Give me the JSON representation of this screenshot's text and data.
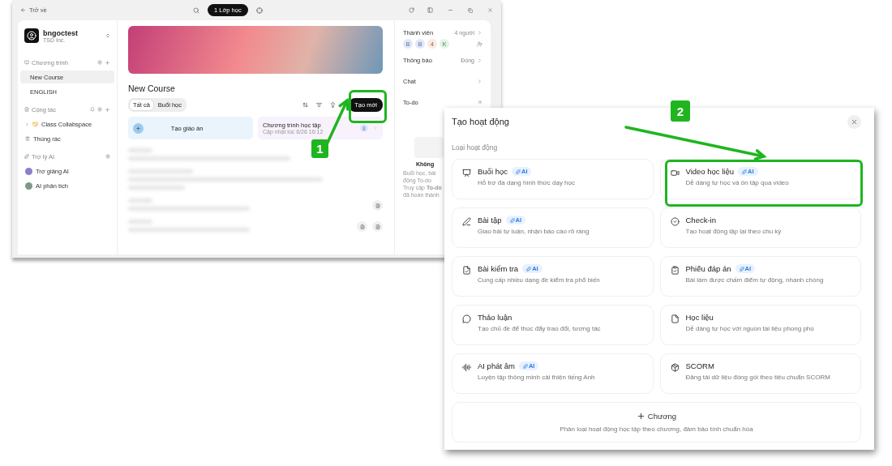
{
  "back_window": {
    "top_bar": {
      "back": "Trở về",
      "class_pill": "1 Lớp học"
    },
    "workspace": {
      "name": "bngoctest",
      "org": "TSD Inc."
    },
    "sidebar": [
      {
        "title": "Chương trình",
        "kind": "program",
        "items": [
          {
            "label": "New Course",
            "kind": "page",
            "selected": true
          },
          {
            "label": "ENGLISH",
            "kind": "page",
            "selected": false
          }
        ]
      },
      {
        "title": "Cộng tác",
        "kind": "collab",
        "items": [
          {
            "label": "Class Collabspace",
            "kind": "folder",
            "selected": false
          },
          {
            "label": "Thùng rác",
            "kind": "trash",
            "selected": false
          }
        ]
      },
      {
        "title": "Trợ lý AI",
        "kind": "ai",
        "items": [
          {
            "label": "Trợ giảng AI",
            "kind": "agent",
            "selected": false
          },
          {
            "label": "AI phân tích",
            "kind": "agent",
            "selected": false
          }
        ]
      }
    ],
    "course": {
      "title": "New Course",
      "tabs": [
        {
          "label": "Tất cả",
          "selected": true
        },
        {
          "label": "Buổi học",
          "selected": false
        }
      ],
      "create_button": "Tạo mới",
      "cards": [
        {
          "kind": "action",
          "title": "Tạo giáo án"
        },
        {
          "kind": "program",
          "title": "Chương trình học tập",
          "subtitle": "Cập nhật lúc 6/26 16:12",
          "count": "8"
        }
      ]
    },
    "right_panel": {
      "rows": [
        {
          "label": "Thành viên",
          "value": "4 người",
          "kind": "link"
        },
        {
          "label": "Thông báo",
          "value": "Đóng",
          "kind": "link"
        },
        {
          "label": "Chat",
          "kind": "link"
        },
        {
          "label": "To-do",
          "kind": "external"
        }
      ],
      "members": [
        {
          "initial": "B",
          "color": "#dfe8fb"
        },
        {
          "initial": "B",
          "color": "#dfe8fb"
        },
        {
          "initial": "4",
          "color": "#fbe9dc"
        },
        {
          "initial": "K",
          "color": "#e1f5e3"
        }
      ],
      "empty_title": "Không",
      "empty_lines": [
        "Buổi học, bài",
        "động To-do",
        "Truy cập **To-do**",
        "đã hoàn thành"
      ]
    }
  },
  "modal": {
    "title": "Tạo hoạt động",
    "section": "Loại hoạt động",
    "activities": [
      {
        "title": "Buổi học",
        "badge": "AI",
        "description": "Hỗ trợ đa dạng hình thức dạy học"
      },
      {
        "title": "Video học liệu",
        "badge": "AI",
        "description": "Dễ dàng tự học và ôn tập qua video"
      },
      {
        "title": "Bài tập",
        "badge": "AI",
        "description": "Giao bài tự luận, nhận báo cáo rõ ràng"
      },
      {
        "title": "Check-in",
        "description": "Tạo hoạt động lặp lại theo chu kỳ"
      },
      {
        "title": "Bài kiểm tra",
        "badge": "AI",
        "description": "Cung cấp nhiều dạng đề kiểm tra phổ biến"
      },
      {
        "title": "Phiếu đáp án",
        "badge": "AI",
        "description": "Bài làm được chấm điểm tự động, nhanh chóng"
      },
      {
        "title": "Thảo luận",
        "description": "Tạo chủ đề để thúc đẩy trao đổi, tương tác"
      },
      {
        "title": "Học liệu",
        "description": "Dễ dàng tự học với nguồn tài liệu phong phú"
      },
      {
        "title": "AI phát âm",
        "badge": "AI",
        "description": "Luyện tập thông minh cải thiện tiếng Anh"
      },
      {
        "title": "SCORM",
        "description": "Đăng tải dữ liệu đóng gói theo tiêu chuẩn SCORM"
      }
    ],
    "chapter": {
      "label": "Chương",
      "description": "Phân loại hoạt động học tập theo chương, đảm bảo tính chuẩn hóa"
    }
  },
  "annotations": [
    {
      "label": "1"
    },
    {
      "label": "2"
    }
  ]
}
